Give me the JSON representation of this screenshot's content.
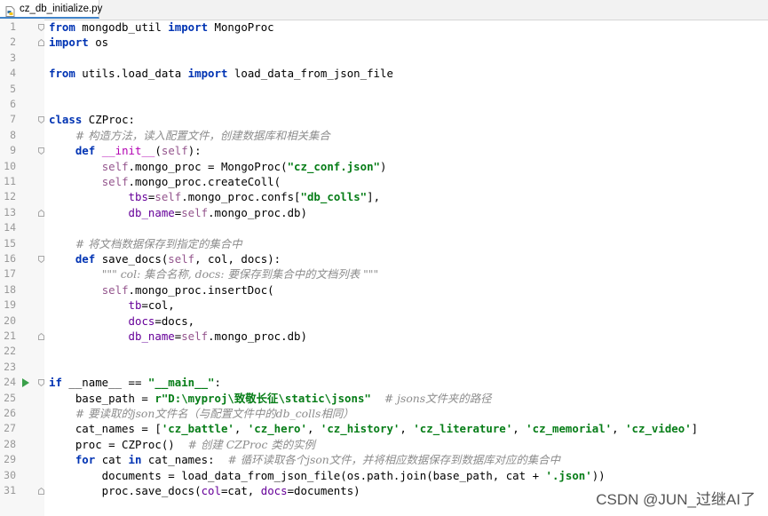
{
  "tab": {
    "filename": "cz_db_initialize.py",
    "icon": "python-file-icon"
  },
  "colors": {
    "keyword": "#0033b3",
    "self": "#94558d",
    "string": "#067d17",
    "comment": "#8c8c8c",
    "param": "#660099",
    "dunder": "#b200b2",
    "linenumber": "#999999",
    "run": "#3aa04a"
  },
  "watermark": "CSDN @JUN_过继AI了",
  "lines": [
    {
      "n": "1",
      "tokens": [
        [
          "k",
          "from"
        ],
        [
          "p",
          " mongodb_util "
        ],
        [
          "k",
          "import"
        ],
        [
          "p",
          " MongoProc"
        ]
      ]
    },
    {
      "n": "2",
      "tokens": [
        [
          "k",
          "import"
        ],
        [
          "p",
          " os"
        ]
      ]
    },
    {
      "n": "3",
      "tokens": []
    },
    {
      "n": "4",
      "tokens": [
        [
          "k",
          "from"
        ],
        [
          "p",
          " utils.load_data "
        ],
        [
          "k",
          "import"
        ],
        [
          "p",
          " load_data_from_json_file"
        ]
      ]
    },
    {
      "n": "5",
      "tokens": []
    },
    {
      "n": "6",
      "tokens": []
    },
    {
      "n": "7",
      "tokens": [
        [
          "k",
          "class"
        ],
        [
          "p",
          " CZProc:"
        ]
      ]
    },
    {
      "n": "8",
      "tokens": [
        [
          "p",
          "    "
        ],
        [
          "c",
          "# 构造方法，读入配置文件，创建数据库和相关集合"
        ]
      ]
    },
    {
      "n": "9",
      "tokens": [
        [
          "p",
          "    "
        ],
        [
          "k",
          "def"
        ],
        [
          "p",
          " "
        ],
        [
          "d",
          "__init__"
        ],
        [
          "p",
          "("
        ],
        [
          "s",
          "self"
        ],
        [
          "p",
          "):"
        ]
      ]
    },
    {
      "n": "10",
      "tokens": [
        [
          "p",
          "        "
        ],
        [
          "s",
          "self"
        ],
        [
          "p",
          ".mongo_proc = MongoProc("
        ],
        [
          "g",
          "\"cz_conf.json\""
        ],
        [
          "p",
          ")"
        ]
      ]
    },
    {
      "n": "11",
      "tokens": [
        [
          "p",
          "        "
        ],
        [
          "s",
          "self"
        ],
        [
          "p",
          ".mongo_proc.createColl("
        ]
      ]
    },
    {
      "n": "12",
      "tokens": [
        [
          "p",
          "            "
        ],
        [
          "a",
          "tbs"
        ],
        [
          "p",
          "="
        ],
        [
          "s",
          "self"
        ],
        [
          "p",
          ".mongo_proc.confs["
        ],
        [
          "g",
          "\"db_colls\""
        ],
        [
          "p",
          "],"
        ]
      ]
    },
    {
      "n": "13",
      "tokens": [
        [
          "p",
          "            "
        ],
        [
          "a",
          "db_name"
        ],
        [
          "p",
          "="
        ],
        [
          "s",
          "self"
        ],
        [
          "p",
          ".mongo_proc.db)"
        ]
      ]
    },
    {
      "n": "14",
      "tokens": []
    },
    {
      "n": "15",
      "tokens": [
        [
          "p",
          "    "
        ],
        [
          "c",
          "# 将文档数据保存到指定的集合中"
        ]
      ]
    },
    {
      "n": "16",
      "tokens": [
        [
          "p",
          "    "
        ],
        [
          "k",
          "def"
        ],
        [
          "p",
          " save_docs("
        ],
        [
          "s",
          "self"
        ],
        [
          "p",
          ", col, docs):"
        ]
      ]
    },
    {
      "n": "17",
      "tokens": [
        [
          "p",
          "        "
        ],
        [
          "c",
          "\"\"\" col: 集合名称, docs: 要保存到集合中的文档列表 \"\"\""
        ]
      ]
    },
    {
      "n": "18",
      "tokens": [
        [
          "p",
          "        "
        ],
        [
          "s",
          "self"
        ],
        [
          "p",
          ".mongo_proc.insertDoc("
        ]
      ]
    },
    {
      "n": "19",
      "tokens": [
        [
          "p",
          "            "
        ],
        [
          "a",
          "tb"
        ],
        [
          "p",
          "=col,"
        ]
      ]
    },
    {
      "n": "20",
      "tokens": [
        [
          "p",
          "            "
        ],
        [
          "a",
          "docs"
        ],
        [
          "p",
          "=docs,"
        ]
      ]
    },
    {
      "n": "21",
      "tokens": [
        [
          "p",
          "            "
        ],
        [
          "a",
          "db_name"
        ],
        [
          "p",
          "="
        ],
        [
          "s",
          "self"
        ],
        [
          "p",
          ".mongo_proc.db)"
        ]
      ]
    },
    {
      "n": "22",
      "tokens": []
    },
    {
      "n": "23",
      "tokens": []
    },
    {
      "n": "24",
      "run": true,
      "tokens": [
        [
          "k",
          "if"
        ],
        [
          "p",
          " __name__ == "
        ],
        [
          "g",
          "\"__main__\""
        ],
        [
          "p",
          ":"
        ]
      ]
    },
    {
      "n": "25",
      "tokens": [
        [
          "p",
          "    base_path = "
        ],
        [
          "g",
          "r\"D:\\myproj\\致敬长征\\static\\jsons\""
        ],
        [
          "p",
          "  "
        ],
        [
          "c",
          "# jsons文件夹的路径"
        ]
      ]
    },
    {
      "n": "26",
      "tokens": [
        [
          "p",
          "    "
        ],
        [
          "c",
          "# 要读取的json文件名（与配置文件中的db_colls相同）"
        ]
      ]
    },
    {
      "n": "27",
      "tokens": [
        [
          "p",
          "    cat_names = ["
        ],
        [
          "g",
          "'cz_battle'"
        ],
        [
          "p",
          ", "
        ],
        [
          "g",
          "'cz_hero'"
        ],
        [
          "p",
          ", "
        ],
        [
          "g",
          "'cz_history'"
        ],
        [
          "p",
          ", "
        ],
        [
          "g",
          "'cz_literature'"
        ],
        [
          "p",
          ", "
        ],
        [
          "g",
          "'cz_memorial'"
        ],
        [
          "p",
          ", "
        ],
        [
          "g",
          "'cz_video'"
        ],
        [
          "p",
          "]"
        ]
      ]
    },
    {
      "n": "28",
      "tokens": [
        [
          "p",
          "    proc = CZProc()  "
        ],
        [
          "c",
          "# 创建 CZProc 类的实例"
        ]
      ]
    },
    {
      "n": "29",
      "tokens": [
        [
          "p",
          "    "
        ],
        [
          "k",
          "for"
        ],
        [
          "p",
          " cat "
        ],
        [
          "k",
          "in"
        ],
        [
          "p",
          " cat_names:  "
        ],
        [
          "c",
          "# 循环读取各个json文件，并将相应数据保存到数据库对应的集合中"
        ]
      ]
    },
    {
      "n": "30",
      "tokens": [
        [
          "p",
          "        documents = load_data_from_json_file(os.path.join(base_path, cat + "
        ],
        [
          "g",
          "'.json'"
        ],
        [
          "p",
          "))"
        ]
      ]
    },
    {
      "n": "31",
      "tokens": [
        [
          "p",
          "        proc.save_docs("
        ],
        [
          "a",
          "col"
        ],
        [
          "p",
          "=cat, "
        ],
        [
          "a",
          "docs"
        ],
        [
          "p",
          "=documents)"
        ]
      ]
    }
  ]
}
